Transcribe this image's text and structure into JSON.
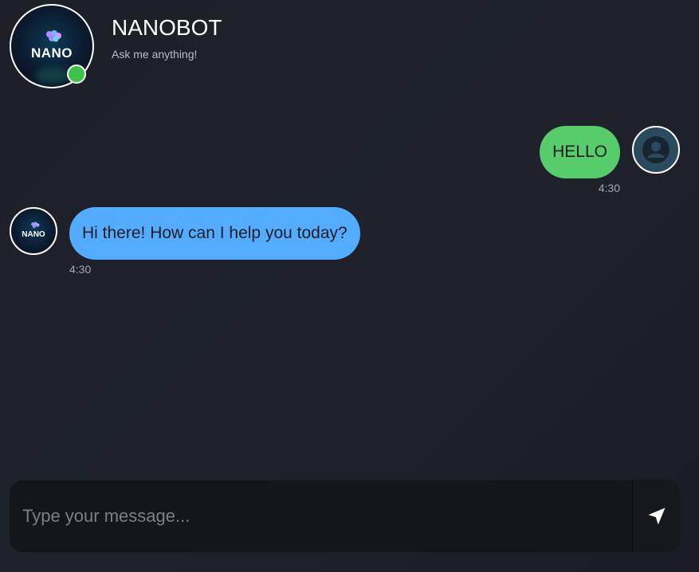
{
  "header": {
    "bot_name": "NANOBOT",
    "subtitle": "Ask me anything!",
    "logo_text": "NANO",
    "online_color": "#3ec24a"
  },
  "messages": [
    {
      "sender": "user",
      "text": "HELLO",
      "time": "4:30",
      "bubble_color": "#56cc6b",
      "avatar_icon": "user-icon"
    },
    {
      "sender": "bot",
      "text": "Hi there! How can I help you today?",
      "time": "4:30",
      "bubble_color": "#53acff",
      "avatar_logo": "NANO"
    }
  ],
  "composer": {
    "placeholder": "Type your message...",
    "value": "",
    "send_icon": "send-icon"
  }
}
